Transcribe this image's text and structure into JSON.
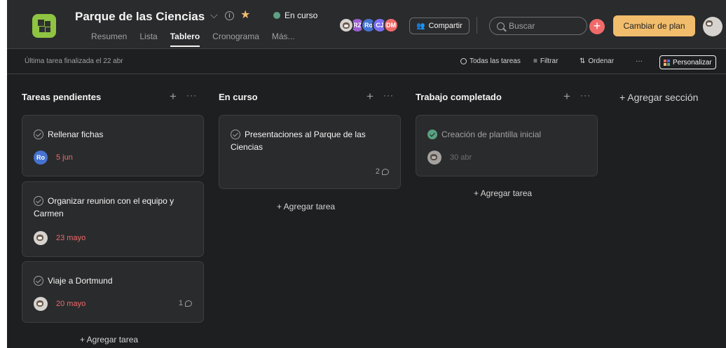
{
  "header": {
    "project_title": "Parque de las Ciencias",
    "status_label": "En curso",
    "tabs": [
      {
        "label": "Resumen"
      },
      {
        "label": "Lista"
      },
      {
        "label": "Tablero"
      },
      {
        "label": "Cronograma"
      },
      {
        "label": "Más..."
      }
    ],
    "active_tab": "Tablero",
    "members": [
      {
        "initials": "",
        "color": "#d6d3cf"
      },
      {
        "initials": "RZ",
        "color": "#9b5fd0"
      },
      {
        "initials": "Ro",
        "color": "#4573d2"
      },
      {
        "initials": "CJ",
        "color": "#7a6ff0"
      },
      {
        "initials": "DM",
        "color": "#f06a6a"
      }
    ],
    "share_label": "Compartir",
    "search_placeholder": "Buscar",
    "upgrade_label": "Cambiar de plan",
    "colors": {
      "accent": "#f1bd6c",
      "status": "#5da283",
      "add": "#f06a6a",
      "project_icon": "#8fc442"
    }
  },
  "toolbar": {
    "last_completed": "Última tarea finalizada el 22 abr",
    "all_tasks": "Todas las tareas",
    "filter": "Filtrar",
    "sort": "Ordenar",
    "more": "···",
    "customize": "Personalizar"
  },
  "board": {
    "add_task_label": "+ Agregar tarea",
    "add_section_label": "+ Agregar sección",
    "columns": [
      {
        "title": "Tareas pendientes",
        "cards": [
          {
            "title": "Rellenar fichas",
            "assignee": "Ro",
            "assignee_color": "#4573d2",
            "due": "5 jun",
            "comments": ""
          },
          {
            "title": "Organizar reunion con el equipo y Carmen",
            "assignee": "",
            "assignee_color": "#d6d3cf",
            "due": "23 mayo",
            "comments": ""
          },
          {
            "title": "Viaje a Dortmund",
            "assignee": "",
            "assignee_color": "#d6d3cf",
            "due": "20 mayo",
            "comments": "1"
          }
        ]
      },
      {
        "title": "En curso",
        "cards": [
          {
            "title": "Presentaciones al Parque de las Ciencias",
            "assignee": "",
            "assignee_color": "",
            "due": "",
            "comments": "2"
          }
        ]
      },
      {
        "title": "Trabajo completado",
        "cards": [
          {
            "title": "Creación de plantilla inicial",
            "assignee": "",
            "assignee_color": "#d6d3cf",
            "due": "30 abr",
            "comments": "",
            "completed": true
          }
        ]
      }
    ]
  }
}
